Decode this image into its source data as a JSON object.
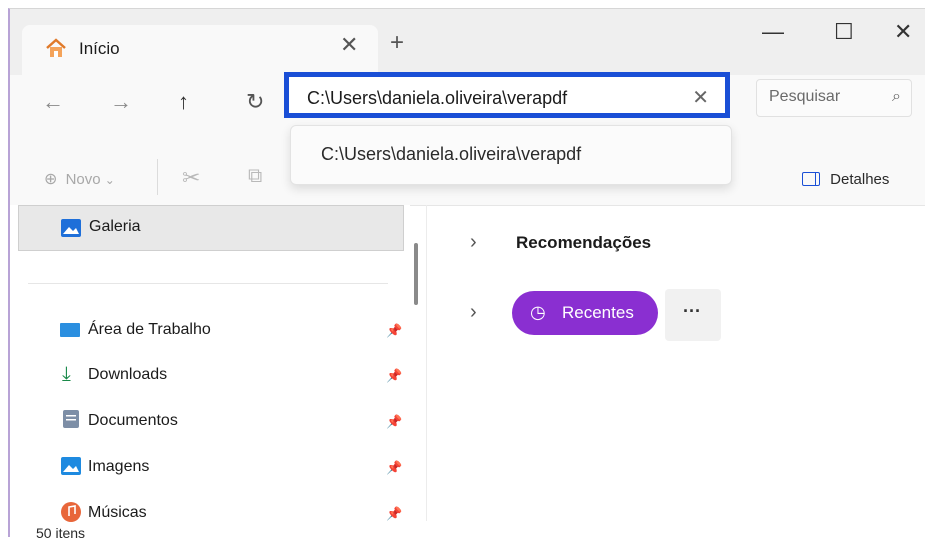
{
  "tab": {
    "title": "Início",
    "close": "✕",
    "new_tab": "+"
  },
  "window_controls": {
    "minimize": "—",
    "maximize": "☐",
    "close": "✕"
  },
  "nav": {
    "back": "←",
    "forward": "→",
    "up": "↑",
    "refresh": "↻"
  },
  "address_bar": {
    "value": "C:\\Users\\daniela.oliveira\\verapdf",
    "clear": "✕"
  },
  "search": {
    "placeholder": "Pesquisar",
    "icon": "⌕"
  },
  "address_suggestion": {
    "text": "C:\\Users\\daniela.oliveira\\verapdf"
  },
  "toolbar": {
    "new_label": "Novo",
    "new_chevron": "⌄",
    "cut_icon": "✂",
    "copy_icon": "⧉",
    "details_label": "Detalhes"
  },
  "sidebar": {
    "selected": {
      "label": "Galeria"
    },
    "items": [
      {
        "label": "Área de Trabalho",
        "icon": "desktop-icon"
      },
      {
        "label": "Downloads",
        "icon": "download-icon"
      },
      {
        "label": "Documentos",
        "icon": "documents-icon"
      },
      {
        "label": "Imagens",
        "icon": "pictures-icon"
      },
      {
        "label": "Músicas",
        "icon": "music-icon"
      }
    ]
  },
  "main": {
    "recommendations_label": "Recomendações",
    "recent_label": "Recentes",
    "more_label": "···"
  },
  "status": {
    "text": "50 itens"
  },
  "colors": {
    "accent": "#8a2fd1",
    "address_highlight": "#1a4fd6"
  }
}
